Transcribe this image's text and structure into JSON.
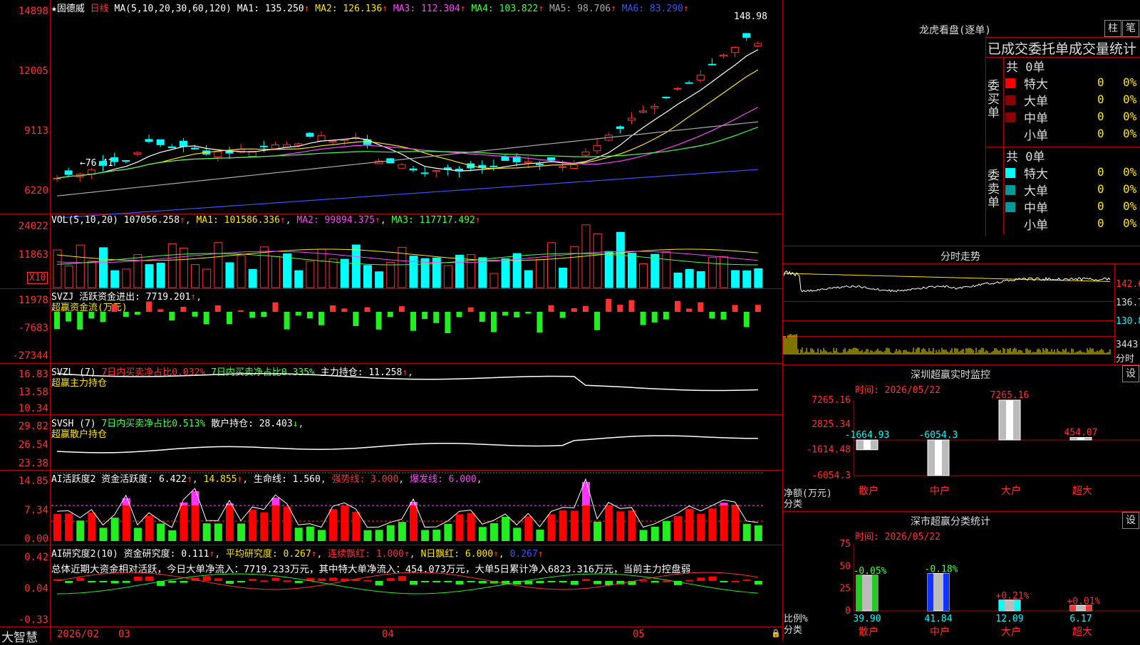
{
  "stock": {
    "name": "固德威",
    "period": "日线",
    "ma_label": "MA(5,10,20,30,60,120)"
  },
  "ma": [
    {
      "label": "MA1:",
      "value": "135.250",
      "arrow": "↑",
      "color": "#ffffff"
    },
    {
      "label": "MA2:",
      "value": "126.136",
      "arrow": "↑",
      "color": "#ffe600"
    },
    {
      "label": "MA3:",
      "value": "112.304",
      "arrow": "↑",
      "color": "#ff44ff"
    },
    {
      "label": "MA4:",
      "value": "103.822",
      "arrow": "↑",
      "color": "#44ff44"
    },
    {
      "label": "MA5:",
      "value": "98.706",
      "arrow": "↑",
      "color": "#aaaaaa"
    },
    {
      "label": "MA6:",
      "value": "83.290",
      "arrow": "↑",
      "color": "#3355ff"
    }
  ],
  "price_axis": [
    "14898",
    "12005",
    "9113",
    "6220"
  ],
  "price_high_label": "148.98",
  "price_low_label": "←76.41",
  "vol": {
    "label": "VOL(5,10,20)",
    "value": "107056.258",
    "ma1": "MA1: 101586.336",
    "ma2": "MA2: 99894.375",
    "ma3": "MA3: 117717.492",
    "axis": [
      "24022",
      "11863"
    ],
    "unit": "X10"
  },
  "svzj": {
    "label": "SVZJ  活跃资金进出:",
    "value": "7719.201",
    "sub": "超赢资金流(万元)",
    "axis": [
      "11978",
      "-7683",
      "-27344"
    ]
  },
  "svzl": {
    "label": "SVZL (7)",
    "t1": "7日内买卖净占比0.032%",
    "t2": "7日内买卖净占比0.335%",
    "t3": "主力持仓: 11.258",
    "sub": "超赢主力持仓",
    "axis": [
      "16.83",
      "13.58",
      "10.34"
    ]
  },
  "svsh": {
    "label": "SVSH (7)",
    "t1": "7日内买卖净占比0.513%",
    "t2": "散户持仓: 28.403",
    "sub": "超赢散户持仓",
    "axis": [
      "29.82",
      "26.54",
      "23.38"
    ]
  },
  "ai_act": {
    "label": "AI活跃度2 资金活跃度: 6.422",
    "v2": "14.855",
    "v3": "生命线: 1.560",
    "v4": "强势线: 3.000",
    "v5": "爆发线: 6.000",
    "axis": [
      "14.85",
      "7.34",
      "0.00"
    ]
  },
  "ai_res": {
    "label": "AI研究度2(10) 资金研究度: 0.111",
    "v2": "平均研究度: 0.267",
    "v3": "连续飘红: 1.000",
    "v4": "N日飘红: 6.000",
    "v5": "0.267",
    "axis": [
      "0.42",
      "0.04",
      "-0.33"
    ],
    "summary": "总体近期大资金相对活跃，今日大单净流入：7719.233万元，其中特大单净流入：454.073万元，大单5日累计净入6823.316万元，当前主力控盘弱"
  },
  "footer": {
    "brand": "大智慧",
    "dates": [
      "2026/02",
      "03",
      "04",
      "05"
    ]
  },
  "lhb": {
    "title": "龙虎看盘(逐单)",
    "btn1": "柱",
    "btn2": "笔",
    "header": "已成交委托单成交量统计",
    "buy": {
      "side": "委买单",
      "total": "共 0单",
      "rows": [
        {
          "name": "特大",
          "count": "0",
          "pct": "0%",
          "color": "#ff0000"
        },
        {
          "name": "大单",
          "count": "0",
          "pct": "0%",
          "color": "#8b0000"
        },
        {
          "name": "中单",
          "count": "0",
          "pct": "0%",
          "color": "#8b0000"
        },
        {
          "name": "小单",
          "count": "0",
          "pct": "0%",
          "color": "#000000"
        }
      ]
    },
    "sell": {
      "side": "委卖单",
      "total": "共 0单",
      "rows": [
        {
          "name": "特大",
          "count": "0",
          "pct": "0%",
          "color": "#00ffff"
        },
        {
          "name": "大单",
          "count": "0",
          "pct": "0%",
          "color": "#009999"
        },
        {
          "name": "中单",
          "count": "0",
          "pct": "0%",
          "color": "#009999"
        },
        {
          "name": "小单",
          "count": "0",
          "pct": "0%",
          "color": "#000000"
        }
      ]
    }
  },
  "intraday": {
    "title": "分时走势",
    "axis": [
      "142.6",
      "136.7",
      "130.8",
      "3443",
      "分时"
    ]
  },
  "sz_monitor": {
    "title": "深圳超赢实时监控",
    "btn": "设",
    "time": "时间: 2026/05/22",
    "axis": [
      "7265.16",
      "2825.34",
      "-1614.48",
      "-6054.3"
    ],
    "unit": "净额(万元)",
    "cat_label": "分类",
    "bars": [
      {
        "name": "散户",
        "value": -1664.93,
        "label": "-1664.93",
        "color": "#00ffff"
      },
      {
        "name": "中户",
        "value": -6054.3,
        "label": "-6054.3",
        "color": "#00ffff"
      },
      {
        "name": "大户",
        "value": 7265.16,
        "label": "7265.16",
        "color": "#ff3232"
      },
      {
        "name": "超大",
        "value": 454.07,
        "label": "454.07",
        "color": "#ff3232"
      }
    ]
  },
  "sz_class": {
    "title": "深市超赢分类统计",
    "btn": "设",
    "time": "时间: 2026/05/22",
    "axis": [
      "75",
      "50",
      "25",
      "0"
    ],
    "unit": "比例%",
    "cat_label": "分类",
    "bars": [
      {
        "name": "散户",
        "value": 39.9,
        "label": "39.90",
        "delta": "-0.05%",
        "color": "#22cc22",
        "dcolor": "#44ff44"
      },
      {
        "name": "中户",
        "value": 41.84,
        "label": "41.84",
        "delta": "-0.18%",
        "color": "#1133ff",
        "dcolor": "#44ff44"
      },
      {
        "name": "大户",
        "value": 12.09,
        "label": "12.09",
        "delta": "+0.21%",
        "color": "#00ffff",
        "dcolor": "#ff3232"
      },
      {
        "name": "超大",
        "value": 6.17,
        "label": "6.17",
        "delta": "+0.01%",
        "color": "#ff3232",
        "dcolor": "#ff3232"
      }
    ]
  }
}
